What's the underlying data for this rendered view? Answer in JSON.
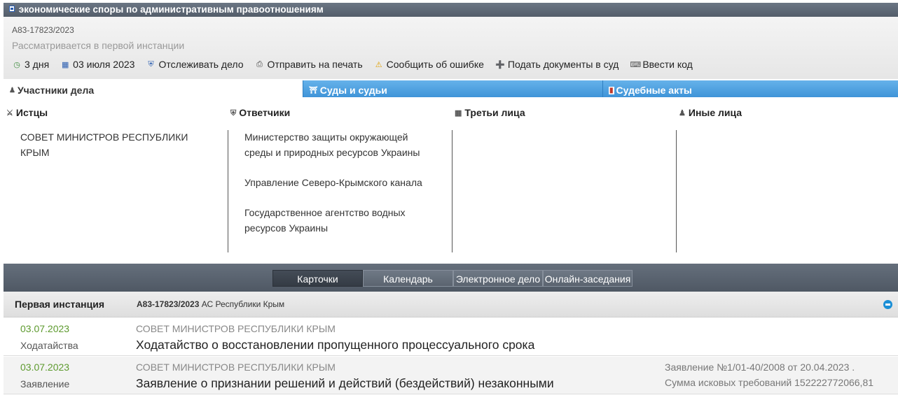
{
  "header": {
    "title": "экономические споры по административным правоотношениям"
  },
  "case": {
    "number": "А83-17823/2023",
    "status": "Рассматривается в первой инстанции"
  },
  "toolbar": {
    "days": "3 дня",
    "date": "03 июля 2023",
    "track": "Отслеживать дело",
    "print": "Отправить на печать",
    "report": "Сообщить об ошибке",
    "submit": "Подать документы в суд",
    "code": "Ввести код"
  },
  "tabs": {
    "participants": "Участники дела",
    "courts": "Суды и судьи",
    "acts": "Судебные акты"
  },
  "parties": {
    "plaintiffs": {
      "label": "Истцы",
      "items": [
        "СОВЕТ МИНИСТРОВ РЕСПУБЛИКИ КРЫМ"
      ]
    },
    "defendants": {
      "label": "Ответчики",
      "items": [
        "Министерство защиты окружающей среды и природных ресурсов Украины",
        "Управление Северо-Крымского канала",
        "Государственное агентство водных ресурсов Украины"
      ]
    },
    "third": {
      "label": "Третьи лица",
      "items": []
    },
    "other": {
      "label": "Иные лица",
      "items": []
    }
  },
  "nav": {
    "cards": "Карточки",
    "calendar": "Календарь",
    "ecase": "Электронное дело",
    "online": "Онлайн-заседания"
  },
  "instance": {
    "label": "Первая инстанция",
    "case_num": "А83-17823/2023",
    "court": "АС Республики Крым"
  },
  "documents": [
    {
      "date": "03.07.2023",
      "type": "Ходатайства",
      "who": "СОВЕТ МИНИСТРОВ РЕСПУБЛИКИ КРЫМ",
      "title": "Ходатайство о восстановлении пропущенного процессуального срока"
    },
    {
      "date": "03.07.2023",
      "type": "Заявление",
      "who": "СОВЕТ МИНИСТРОВ РЕСПУБЛИКИ КРЫМ",
      "title": "Заявление о признании решений и действий (бездействий) незаконными",
      "extra1": "Заявление №1/01-40/2008 от 20.04.2023 .",
      "extra2": "Сумма исковых требований 152222772066,81"
    }
  ]
}
